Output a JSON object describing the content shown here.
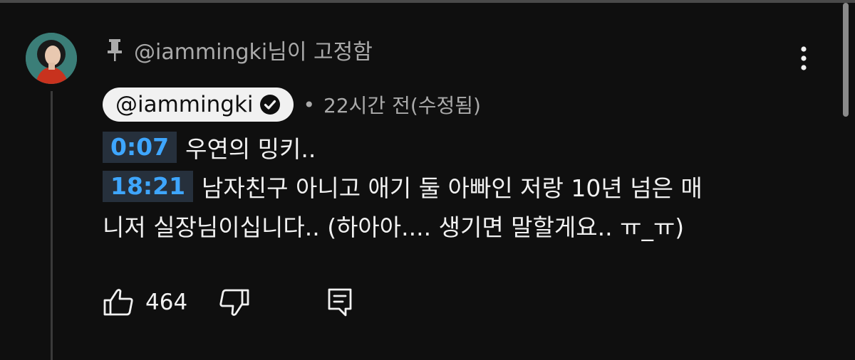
{
  "pin_label": {
    "handle": "@iammingki",
    "suffix": "님이 고정함"
  },
  "comment": {
    "author": "@iammingki",
    "verified": true,
    "separator": "•",
    "time": "22시간 전(수정됨)",
    "lines": [
      {
        "timestamp": "0:07",
        "text": "우연의 밍키.."
      },
      {
        "timestamp": "18:21",
        "text": "남자친구 아니고 애기 둘 아빠인 저랑 10년 넘은 매"
      },
      {
        "timestamp": "",
        "text": "니저 실장님이십니다.. (하아아.... 생기면 말할게요.. ㅠ_ㅠ)"
      }
    ],
    "like_count": "464"
  },
  "icons": {
    "pin": "pin-icon",
    "verified": "check-circle-icon",
    "more": "three-dots-vertical-icon",
    "like": "thumbs-up-icon",
    "dislike": "thumbs-down-icon",
    "reply": "reply-comment-icon"
  },
  "colors": {
    "background": "#0f0f0f",
    "text_primary": "#f1f1f1",
    "text_secondary": "#aaaaaa",
    "timestamp_link": "#3ea6ff",
    "timestamp_bg": "#26303c",
    "chip_bg": "#f1f1f1"
  }
}
